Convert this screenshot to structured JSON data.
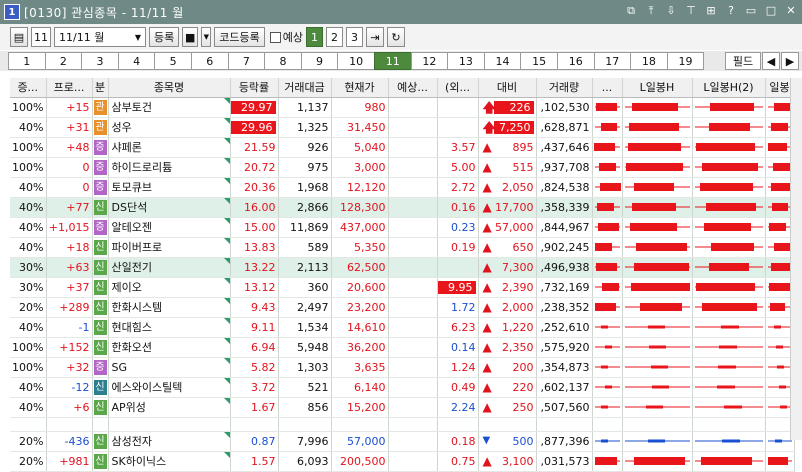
{
  "window": {
    "number": "1",
    "title": "[0130] 관심종목 - 11/11 월"
  },
  "toolbar": {
    "group_no": "11",
    "group_name": "11/11 월",
    "register_label": "등록",
    "code_register_label": "코드등록",
    "expect_label": "예상",
    "pages": [
      "1",
      "2",
      "3"
    ]
  },
  "tabs": [
    "1",
    "2",
    "3",
    "4",
    "5",
    "6",
    "7",
    "8",
    "9",
    "10",
    "11",
    "12",
    "13",
    "14",
    "15",
    "16",
    "17",
    "18",
    "19"
  ],
  "active_tab": "11",
  "filter_label": "필드",
  "columns": [
    "증...",
    "프로...",
    "분",
    "종목명",
    "등락률",
    "거래대금",
    "현재가",
    "예상...",
    "(외...",
    "대비",
    "거래량",
    "...",
    "L일봉H",
    "L일봉H(2)",
    "일봉"
  ],
  "rows": [
    {
      "margin": "100%",
      "prog": "+15",
      "tag": "관",
      "tag_color": "#e8912b",
      "name": "삼부토건",
      "rate": "29.97",
      "amount": "1,137",
      "price": "980",
      "expect": "",
      "foreign": "",
      "dir": "up",
      "diff": "226",
      "diff_bg": true,
      "volume": ",102,530",
      "rate_bg": true,
      "prog_color": "up",
      "color": "up",
      "hl": false
    },
    {
      "margin": "40%",
      "prog": "+31",
      "tag": "관",
      "tag_color": "#e8912b",
      "name": "성우",
      "rate": "29.96",
      "amount": "1,325",
      "price": "31,450",
      "expect": "",
      "foreign": "",
      "dir": "up",
      "diff": "7,250",
      "diff_bg": true,
      "volume": ",628,871",
      "rate_bg": true,
      "prog_color": "up",
      "color": "up",
      "hl": false
    },
    {
      "margin": "100%",
      "prog": "+48",
      "tag": "증",
      "tag_color": "#b264c7",
      "name": "샤페론",
      "rate": "21.59",
      "amount": "926",
      "price": "5,040",
      "expect": "",
      "foreign": "3.57",
      "dir": "tri",
      "diff": "895",
      "volume": ",437,646",
      "prog_color": "up",
      "color": "up",
      "hl": false
    },
    {
      "margin": "100%",
      "prog": "0",
      "tag": "증",
      "tag_color": "#b264c7",
      "name": "하이드로리튬",
      "rate": "20.72",
      "amount": "975",
      "price": "3,000",
      "expect": "",
      "foreign": "5.00",
      "dir": "tri",
      "diff": "515",
      "volume": ",937,708",
      "prog_color": "up",
      "color": "up",
      "hl": false
    },
    {
      "margin": "40%",
      "prog": "0",
      "tag": "증",
      "tag_color": "#b264c7",
      "name": "토모큐브",
      "rate": "20.36",
      "amount": "1,968",
      "price": "12,120",
      "expect": "",
      "foreign": "2.72",
      "dir": "tri",
      "diff": "2,050",
      "volume": ",824,538",
      "prog_color": "up",
      "color": "up",
      "hl": false
    },
    {
      "margin": "40%",
      "prog": "+77",
      "tag": "신",
      "tag_color": "#5aa84a",
      "name": "DS단석",
      "rate": "16.00",
      "amount": "2,866",
      "price": "128,300",
      "expect": "",
      "foreign": "0.16",
      "dir": "tri",
      "diff": "17,700",
      "volume": ",358,339",
      "prog_color": "up",
      "color": "up",
      "hl": true
    },
    {
      "margin": "40%",
      "prog": "+1,015",
      "tag": "증",
      "tag_color": "#b264c7",
      "name": "알테오젠",
      "rate": "15.00",
      "amount": "11,869",
      "price": "437,000",
      "expect": "",
      "foreign": "0.23",
      "foreign_color": "dn",
      "dir": "tri",
      "diff": "57,000",
      "volume": ",844,967",
      "prog_color": "up",
      "color": "up",
      "hl": false
    },
    {
      "margin": "40%",
      "prog": "+18",
      "tag": "신",
      "tag_color": "#5aa84a",
      "name": "파이버프로",
      "rate": "13.83",
      "amount": "589",
      "price": "5,350",
      "expect": "",
      "foreign": "0.19",
      "dir": "tri",
      "diff": "650",
      "volume": ",902,245",
      "prog_color": "up",
      "color": "up",
      "hl": false
    },
    {
      "margin": "30%",
      "prog": "+63",
      "tag": "신",
      "tag_color": "#5aa84a",
      "name": "산일전기",
      "rate": "13.22",
      "amount": "2,113",
      "price": "62,500",
      "expect": "",
      "foreign": "",
      "dir": "tri",
      "diff": "7,300",
      "volume": ",496,938",
      "prog_color": "up",
      "color": "up",
      "hl": true
    },
    {
      "margin": "30%",
      "prog": "+37",
      "tag": "신",
      "tag_color": "#5aa84a",
      "name": "제이오",
      "rate": "13.12",
      "amount": "360",
      "price": "20,600",
      "expect": "",
      "foreign": "9.95",
      "foreign_bg": true,
      "dir": "tri",
      "diff": "2,390",
      "volume": ",732,169",
      "prog_color": "up",
      "color": "up",
      "hl": false
    },
    {
      "margin": "20%",
      "prog": "+289",
      "tag": "신",
      "tag_color": "#5aa84a",
      "name": "한화시스템",
      "rate": "9.43",
      "amount": "2,497",
      "price": "23,200",
      "expect": "",
      "foreign": "1.72",
      "foreign_color": "dn",
      "dir": "tri",
      "diff": "2,000",
      "volume": ",238,352",
      "prog_color": "up",
      "color": "up",
      "hl": false
    },
    {
      "margin": "40%",
      "prog": "-1",
      "tag": "신",
      "tag_color": "#5aa84a",
      "name": "현대힘스",
      "rate": "9.11",
      "amount": "1,534",
      "price": "14,610",
      "expect": "",
      "foreign": "6.23",
      "dir": "tri",
      "diff": "1,220",
      "volume": ",252,610",
      "prog_color": "dn",
      "color": "up",
      "hl": false
    },
    {
      "margin": "100%",
      "prog": "+152",
      "tag": "신",
      "tag_color": "#5aa84a",
      "name": "한화오션",
      "rate": "6.94",
      "amount": "5,948",
      "price": "36,200",
      "expect": "",
      "foreign": "0.14",
      "foreign_color": "dn",
      "dir": "tri",
      "diff": "2,350",
      "volume": ",575,920",
      "prog_color": "up",
      "color": "up",
      "hl": false
    },
    {
      "margin": "100%",
      "prog": "+32",
      "tag": "증",
      "tag_color": "#b264c7",
      "name": "SG",
      "rate": "5.82",
      "amount": "1,303",
      "price": "3,635",
      "expect": "",
      "foreign": "1.24",
      "dir": "tri",
      "diff": "200",
      "volume": ",354,873",
      "prog_color": "up",
      "color": "up",
      "hl": false
    },
    {
      "margin": "40%",
      "prog": "-12",
      "tag": "신",
      "tag_color": "#2b7f8e",
      "name": "에스와이스틸텍",
      "rate": "3.72",
      "amount": "521",
      "price": "6,140",
      "expect": "",
      "foreign": "0.49",
      "dir": "tri",
      "diff": "220",
      "volume": ",602,137",
      "prog_color": "dn",
      "color": "up",
      "hl": false
    },
    {
      "margin": "40%",
      "prog": "+6",
      "tag": "신",
      "tag_color": "#5aa84a",
      "name": "AP위성",
      "rate": "1.67",
      "amount": "856",
      "price": "15,200",
      "expect": "",
      "foreign": "2.24",
      "foreign_color": "dn",
      "dir": "tri",
      "diff": "250",
      "volume": ",507,560",
      "prog_color": "up",
      "color": "up",
      "hl": false
    },
    {
      "gap": true
    },
    {
      "margin": "20%",
      "prog": "-436",
      "tag": "신",
      "tag_color": "#5aa84a",
      "name": "삼성전자",
      "rate": "0.87",
      "amount": "7,996",
      "price": "57,000",
      "expect": "",
      "foreign": "0.18",
      "dir": "dtri",
      "diff": "500",
      "volume": ",877,396",
      "prog_color": "dn",
      "color": "dn",
      "hl": false
    },
    {
      "margin": "20%",
      "prog": "+981",
      "tag": "신",
      "tag_color": "#5aa84a",
      "name": "SK하이닉스",
      "rate": "1.57",
      "amount": "6,093",
      "price": "200,500",
      "expect": "",
      "foreign": "0.75",
      "dir": "tri",
      "diff": "3,100",
      "volume": ",031,573",
      "prog_color": "up",
      "color": "up",
      "hl": false
    }
  ]
}
